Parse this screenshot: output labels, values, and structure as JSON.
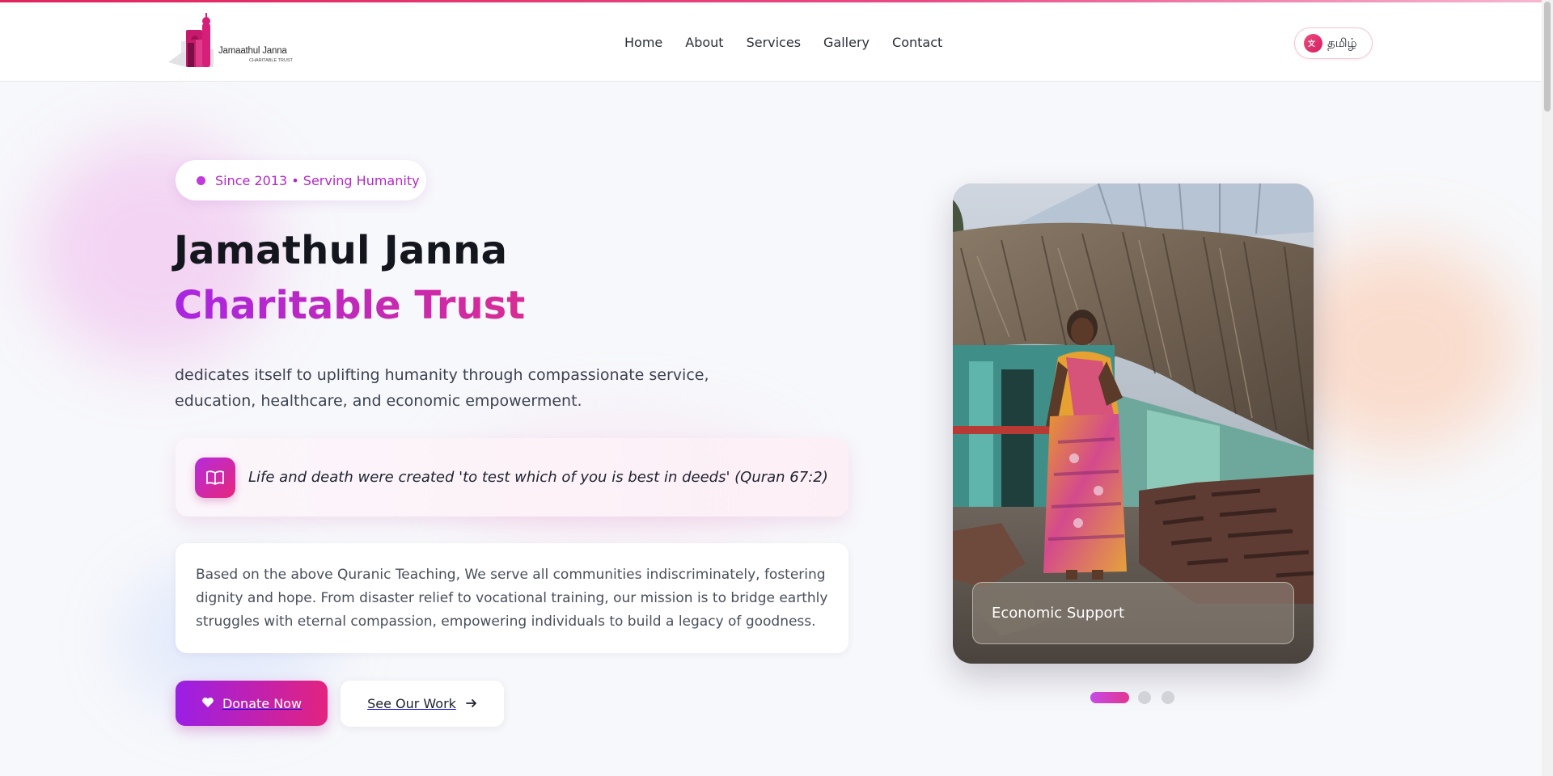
{
  "brand": {
    "name": "Jamaathul Janna",
    "tagline": "CHARITABLE TRUST",
    "colors": {
      "primary": "#b427c9",
      "accent": "#e3237f",
      "gradient_start": "#9a1fe6"
    }
  },
  "nav": {
    "items": [
      {
        "label": "Home"
      },
      {
        "label": "About"
      },
      {
        "label": "Services"
      },
      {
        "label": "Gallery"
      },
      {
        "label": "Contact"
      }
    ]
  },
  "language": {
    "icon": "translate-icon",
    "label": "தமிழ்"
  },
  "hero": {
    "badge": "Since 2013 • Serving Humanity",
    "title_line1": "Jamathul Janna",
    "title_line2": "Charitable Trust",
    "lead": "dedicates itself to uplifting humanity through compassionate service, education, healthcare, and economic empowerment.",
    "quote": {
      "icon": "book-icon",
      "text": "Life and death were created 'to test which of you is best in deeds' (Quran 67:2)"
    },
    "description": "Based on the above Quranic Teaching, We serve all communities indiscriminately, fostering dignity and hope. From disaster relief to vocational training, our mission is to bridge earthly struggles with eternal compassion, empowering individuals to build a legacy of goodness.",
    "buttons": {
      "donate": {
        "label": "Donate Now",
        "icon": "heart-icon"
      },
      "work": {
        "label": "See Our Work",
        "icon": "arrow-right-icon"
      }
    }
  },
  "carousel": {
    "current_caption": "Economic Support",
    "slide_count": 3,
    "active_index": 0
  }
}
